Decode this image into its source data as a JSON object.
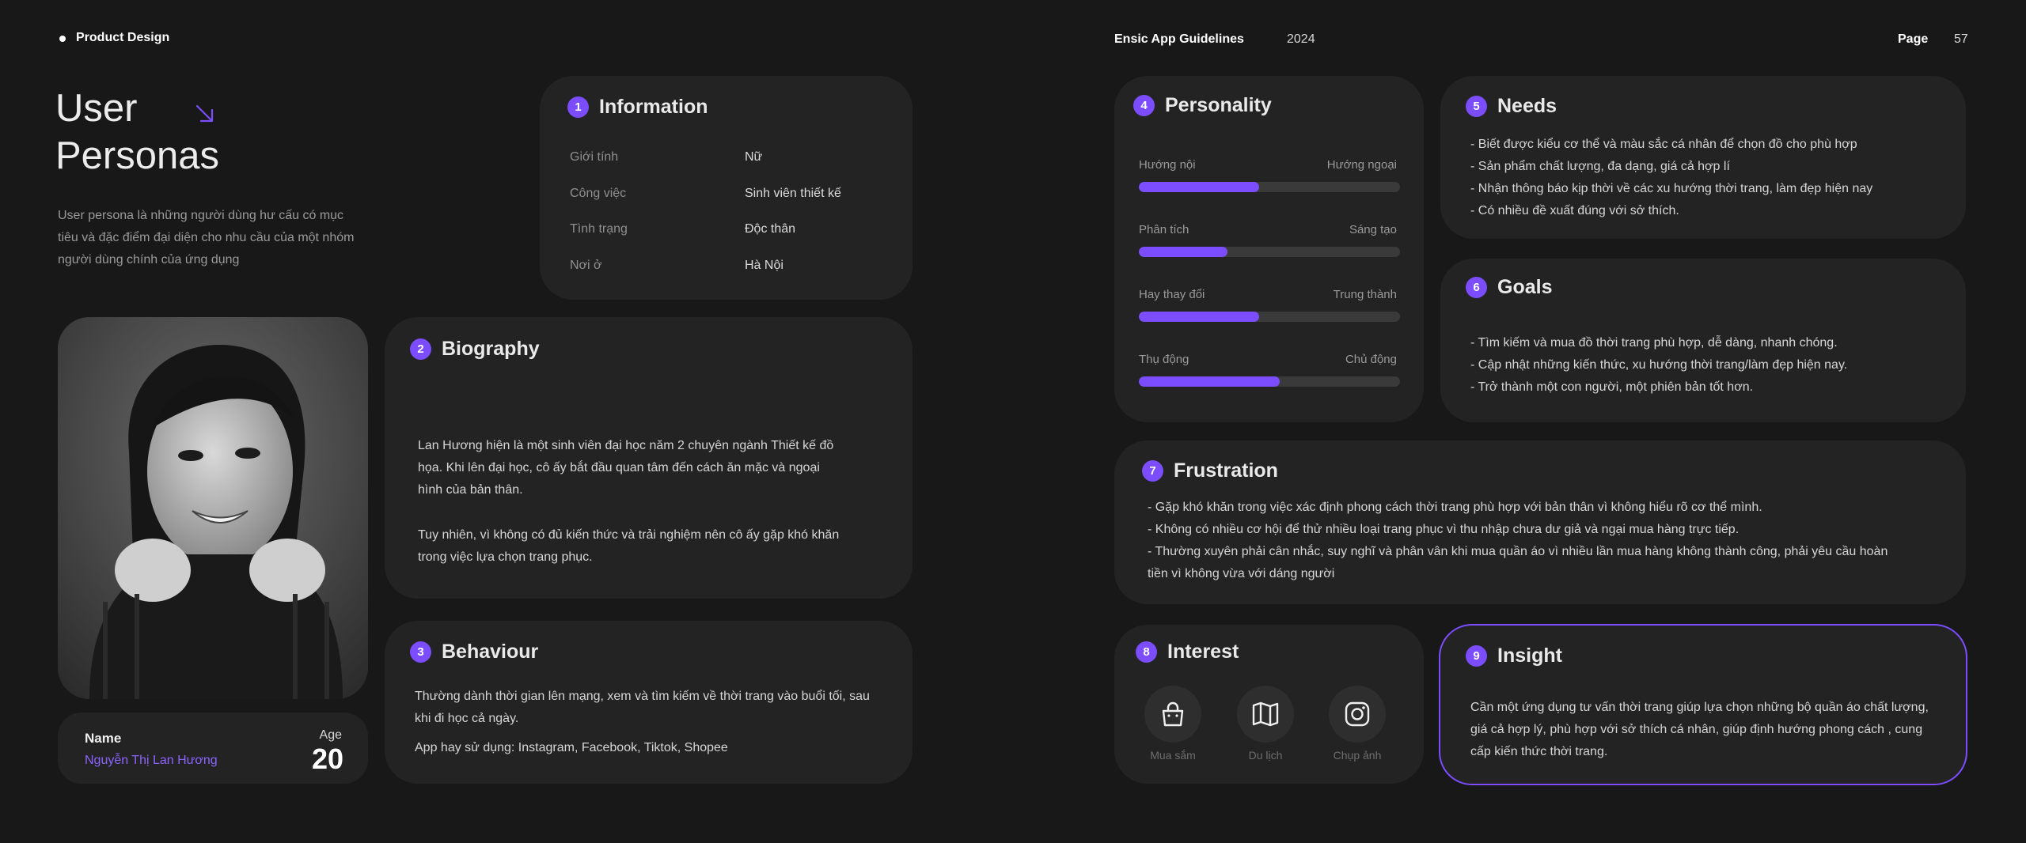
{
  "header": {
    "brand": "Product Design",
    "doc_title": "Ensic App Guidelines",
    "year": "2024",
    "page_label": "Page",
    "page_number": "57"
  },
  "title": {
    "line1": "User",
    "line2": "Personas",
    "arrow_icon": "arrow-down-right-icon"
  },
  "intro": "User persona là những người dùng hư cấu có mục tiêu và đặc điểm đại diện cho nhu cầu của một nhóm người dùng chính của ứng dụng",
  "colors": {
    "accent": "#7b4dff",
    "card": "#232323",
    "background": "#181818"
  },
  "profile": {
    "name_label": "Name",
    "name": "Nguyễn Thị Lan Hương",
    "age_label": "Age",
    "age": "20"
  },
  "information": {
    "number": "1",
    "title": "Information",
    "rows": [
      {
        "label": "Giới tính",
        "value": "Nữ"
      },
      {
        "label": "Công việc",
        "value": "Sinh viên thiết kế"
      },
      {
        "label": "Tình trạng",
        "value": "Độc thân"
      },
      {
        "label": "Nơi ở",
        "value": "Hà Nội"
      }
    ]
  },
  "biography": {
    "number": "2",
    "title": "Biography",
    "p1": "Lan Hương hiện là một sinh viên đại học năm 2 chuyên ngành Thiết kế đồ họa. Khi lên đại học, cô ấy bắt đầu quan tâm đến cách ăn mặc và ngoại hình của bản thân.",
    "p2": "Tuy nhiên, vì không có đủ kiến thức và trải nghiệm nên cô ấy gặp khó khăn trong việc lựa chọn trang phục."
  },
  "behaviour": {
    "number": "3",
    "title": "Behaviour",
    "p1": "Thường dành thời gian lên mạng, xem và tìm kiếm về thời trang vào buổi tối, sau khi đi học cả ngày.",
    "p2": "App hay sử dụng: Instagram, Facebook, Tiktok, Shopee"
  },
  "personality": {
    "number": "4",
    "title": "Personality",
    "traits": [
      {
        "left": "Hướng nội",
        "right": "Hướng ngoại",
        "level": 0.46
      },
      {
        "left": "Phân tích",
        "right": "Sáng tạo",
        "level": 0.34
      },
      {
        "left": "Hay thay đổi",
        "right": "Trung thành",
        "level": 0.46
      },
      {
        "left": "Thụ động",
        "right": "Chủ động",
        "level": 0.54
      }
    ]
  },
  "needs": {
    "number": "5",
    "title": "Needs",
    "items": [
      "- Biết được kiểu cơ thể và màu sắc cá nhân để chọn đồ cho phù hợp",
      "- Sản phẩm chất lượng, đa dạng, giá cả hợp lí",
      "- Nhận thông báo kịp thời về các xu hướng thời trang, làm đẹp hiện nay",
      "- Có nhiều đề xuất đúng với sở thích."
    ]
  },
  "goals": {
    "number": "6",
    "title": "Goals",
    "items": [
      "- Tìm kiếm và mua đồ thời trang phù hợp, dễ dàng, nhanh chóng.",
      "- Cập nhật những kiến thức, xu hướng thời trang/làm đẹp hiện nay.",
      "- Trở thành một con người, một phiên bản tốt hơn."
    ]
  },
  "frustration": {
    "number": "7",
    "title": "Frustration",
    "items": [
      "- Gặp khó khăn trong việc xác định phong cách thời trang phù hợp với bản thân vì không hiểu rõ cơ thể mình.",
      "- Không có nhiều cơ hội để thử nhiều loại trang phục vì thu nhập chưa dư giả và ngại mua hàng trực tiếp.",
      "- Thường xuyên phải cân nhắc, suy nghĩ và phân vân khi mua quần áo vì nhiều lần mua hàng không thành công, phải yêu cầu hoàn",
      "tiền vì không vừa với dáng người"
    ]
  },
  "interest": {
    "number": "8",
    "title": "Interest",
    "items": [
      {
        "icon": "shopping-bag-icon",
        "label": "Mua sắm"
      },
      {
        "icon": "map-icon",
        "label": "Du lịch"
      },
      {
        "icon": "instagram-icon",
        "label": "Chụp ảnh"
      }
    ]
  },
  "insight": {
    "number": "9",
    "title": "Insight",
    "text": "Cần một ứng dụng tư vấn thời trang giúp lựa chọn những bộ quần áo chất lượng, giá cả hợp lý, phù hợp với sở thích cá nhân, giúp định hướng phong cách , cung cấp kiến thức thời trang."
  }
}
